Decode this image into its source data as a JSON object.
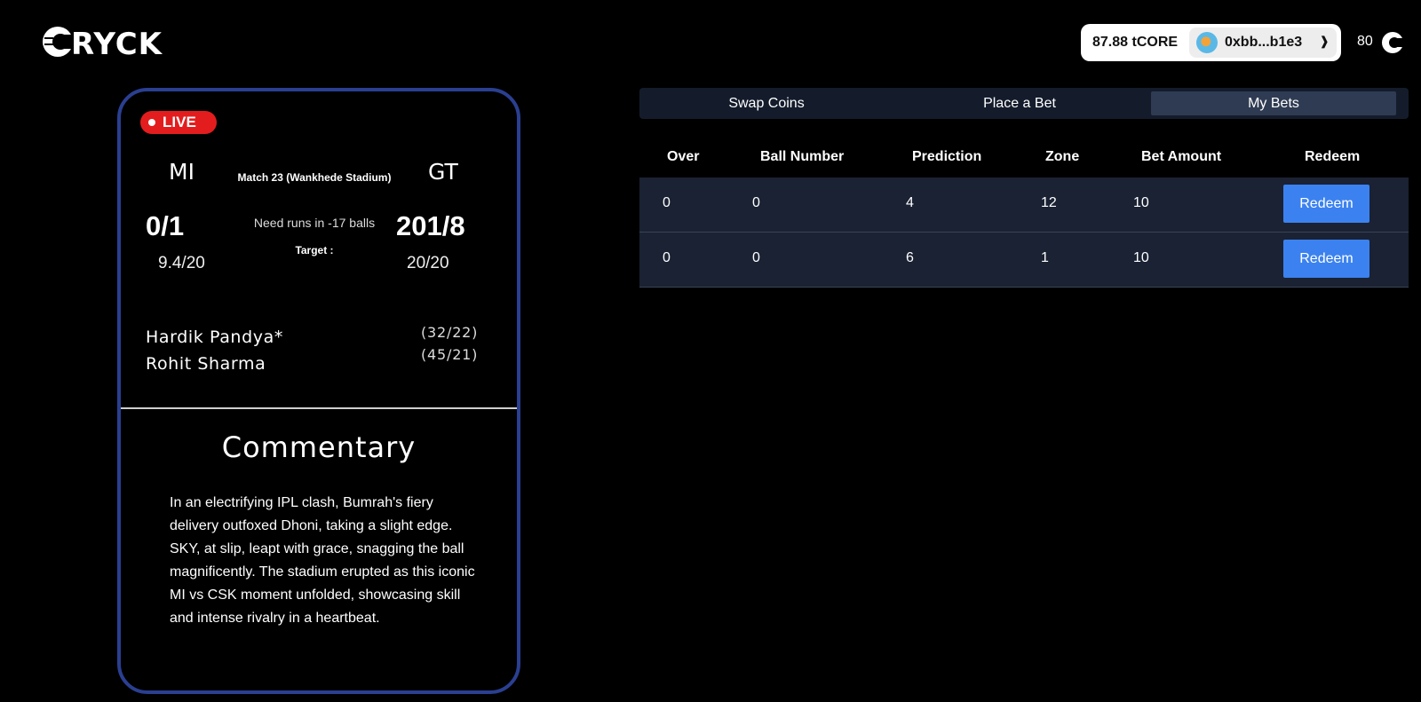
{
  "header": {
    "logo_text": "CRYCK",
    "balance": "87.88 tCORE",
    "account_address": "0xbb...b1e3",
    "coin_count": "80"
  },
  "match": {
    "live_label": "LIVE",
    "team_a": "MI",
    "team_b": "GT",
    "match_info": "Match 23 (Wankhede Stadium)",
    "score_a": "0/1",
    "score_b": "201/8",
    "overs_a": "9.4/20",
    "overs_b": "20/20",
    "need_text": "Need runs in -17 balls",
    "target_label": "Target :",
    "batters": [
      {
        "name": "Hardik Pandya*",
        "score": "(32/22)"
      },
      {
        "name": "Rohit Sharma",
        "score": "(45/21)"
      }
    ],
    "commentary_title": "Commentary",
    "commentary_text": "In an electrifying IPL clash, Bumrah's fiery delivery outfoxed Dhoni, taking a slight edge. SKY, at slip, leapt with grace, snagging the ball magnificently. The stadium erupted as this iconic MI vs CSK moment unfolded, showcasing skill and intense rivalry in a heartbeat."
  },
  "tabs": [
    {
      "label": "Swap Coins",
      "active": false
    },
    {
      "label": "Place a Bet",
      "active": false
    },
    {
      "label": "My Bets",
      "active": true
    }
  ],
  "bets_table": {
    "columns": [
      "Over",
      "Ball Number",
      "Prediction",
      "Zone",
      "Bet Amount",
      "Redeem"
    ],
    "rows": [
      {
        "over": "0",
        "ball_number": "0",
        "prediction": "4",
        "zone": "12",
        "bet_amount": "10",
        "redeem_label": "Redeem"
      },
      {
        "over": "0",
        "ball_number": "0",
        "prediction": "6",
        "zone": "1",
        "bet_amount": "10",
        "redeem_label": "Redeem"
      }
    ]
  },
  "colors": {
    "background": "#000000",
    "card_border": "#2a3f91",
    "live_badge": "#e31d1d",
    "tab_bar": "#141c2c",
    "tab_active": "#2f3b52",
    "row_bg": "#1a2233",
    "button": "#3b82f0"
  }
}
